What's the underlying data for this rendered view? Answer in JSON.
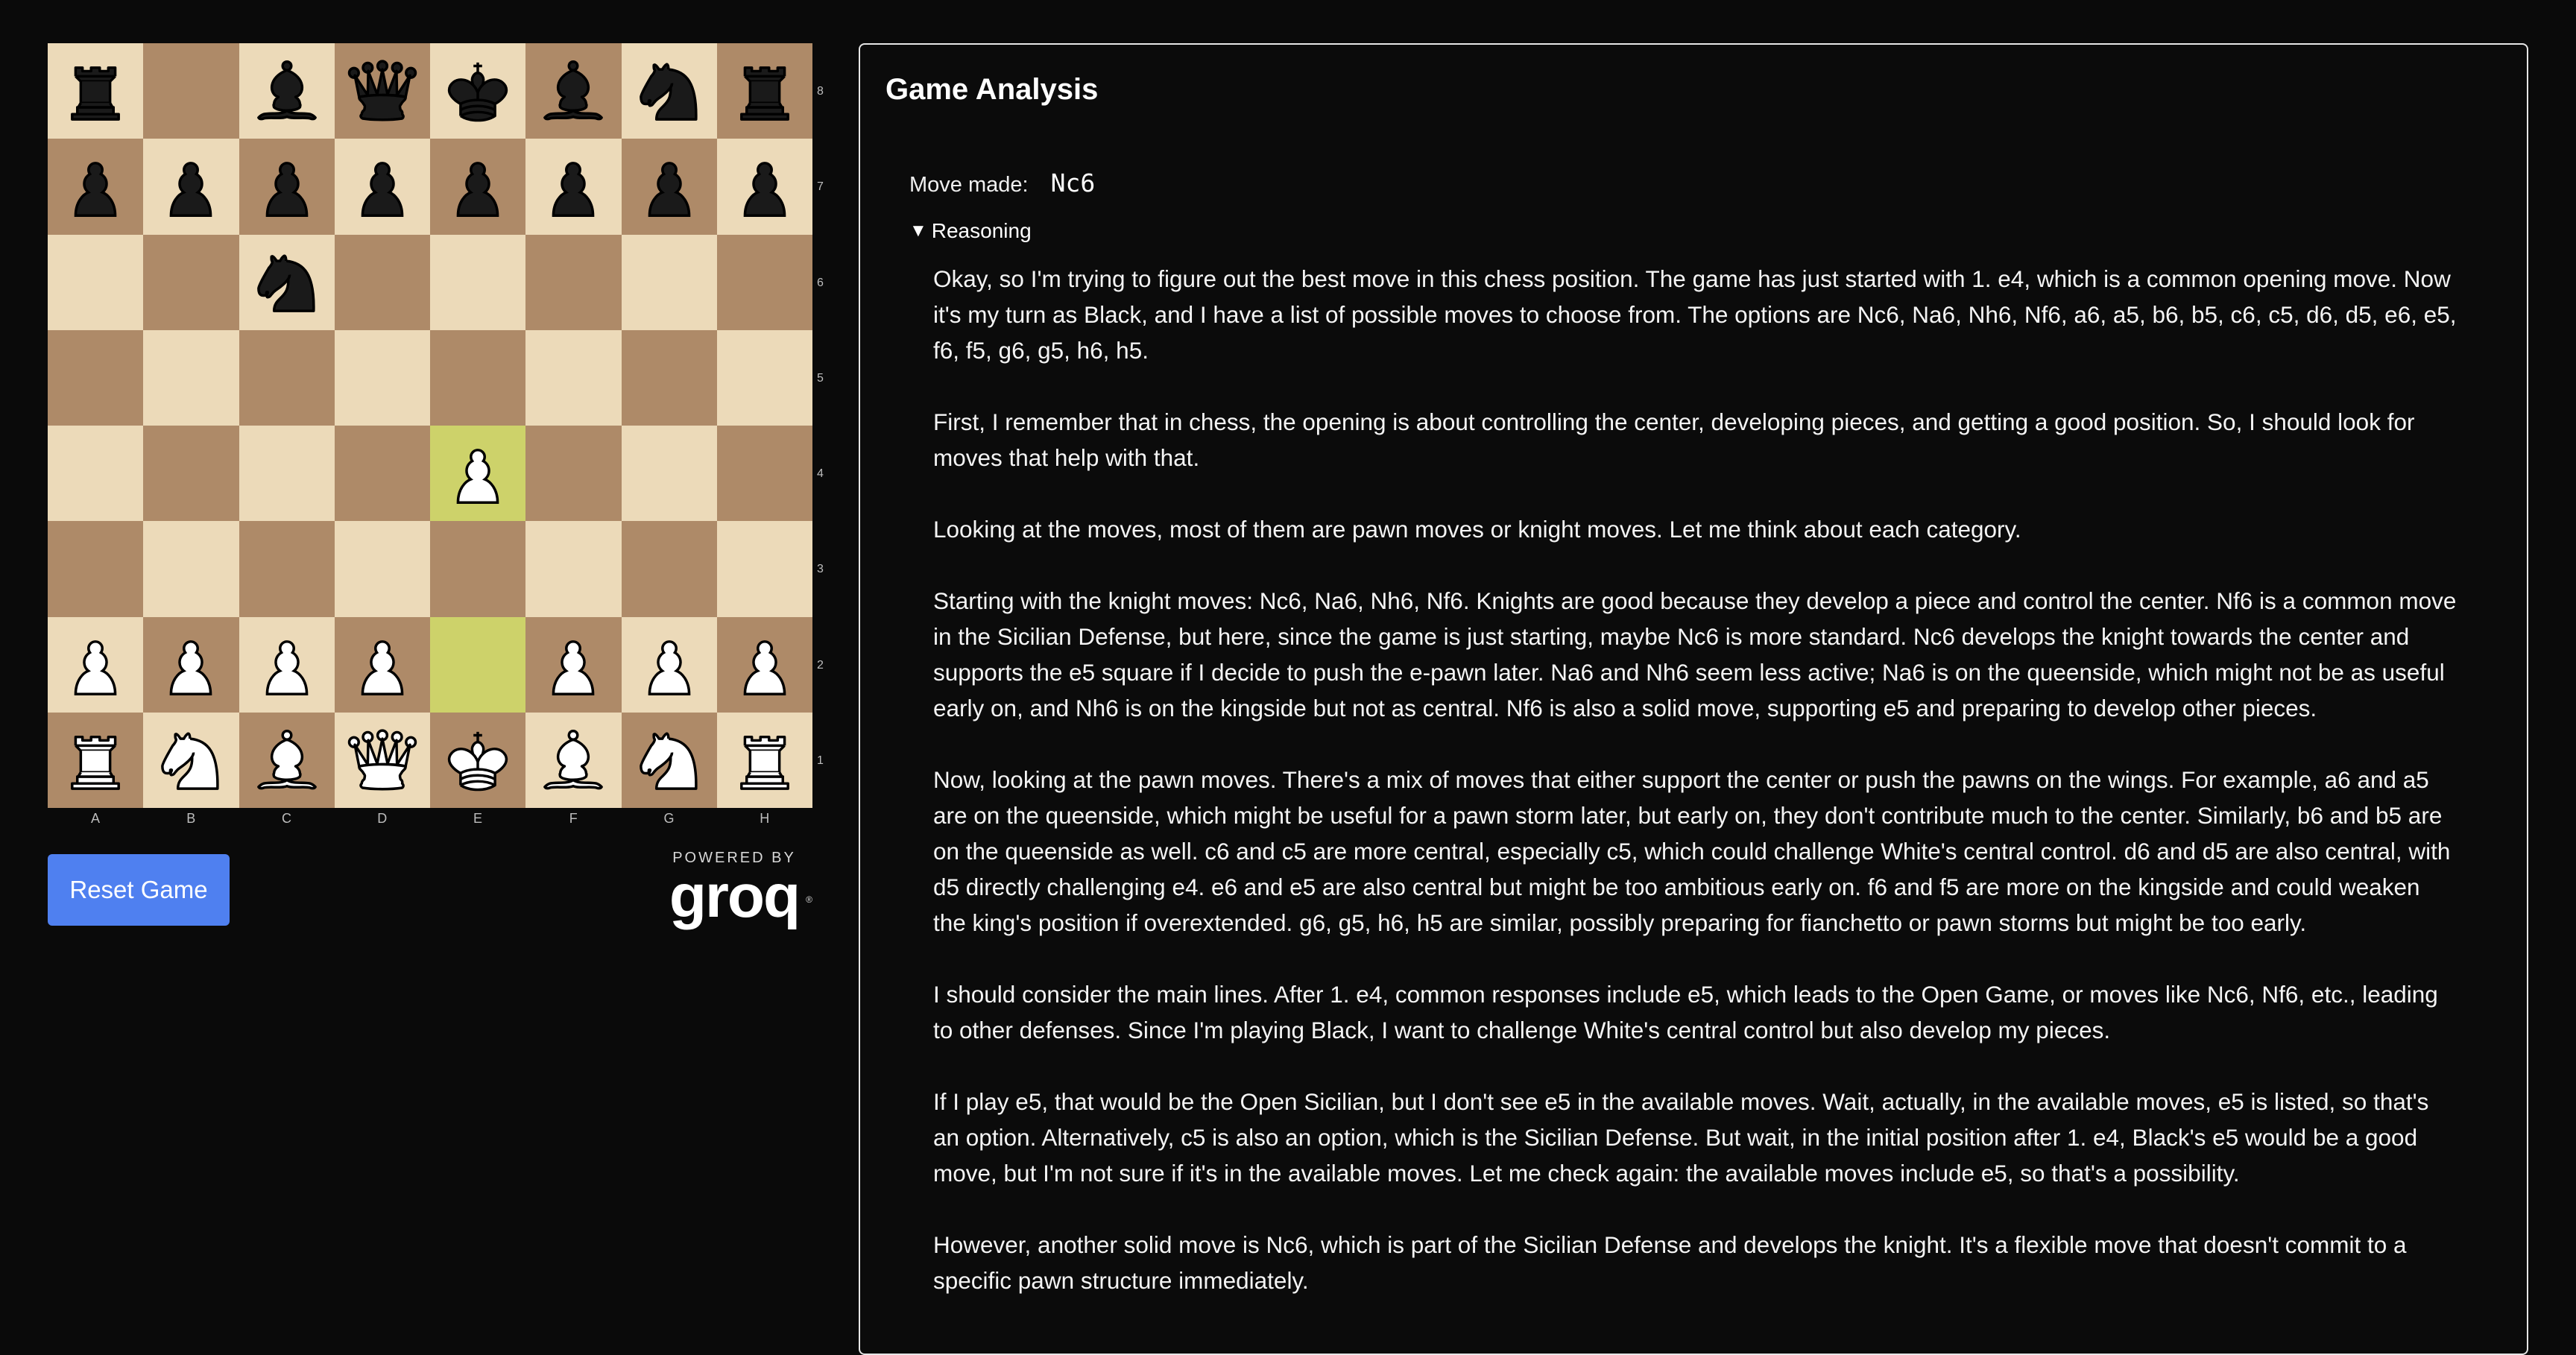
{
  "board": {
    "files": [
      "A",
      "B",
      "C",
      "D",
      "E",
      "F",
      "G",
      "H"
    ],
    "ranks": [
      "8",
      "7",
      "6",
      "5",
      "4",
      "3",
      "2",
      "1"
    ],
    "position": [
      [
        "bR",
        "",
        "bB",
        "bQ",
        "bK",
        "bB",
        "bN",
        "bR"
      ],
      [
        "bP",
        "bP",
        "bP",
        "bP",
        "bP",
        "bP",
        "bP",
        "bP"
      ],
      [
        "",
        "",
        "bN",
        "",
        "",
        "",
        "",
        ""
      ],
      [
        "",
        "",
        "",
        "",
        "",
        "",
        "",
        ""
      ],
      [
        "",
        "",
        "",
        "",
        "wP",
        "",
        "",
        ""
      ],
      [
        "",
        "",
        "",
        "",
        "",
        "",
        "",
        ""
      ],
      [
        "wP",
        "wP",
        "wP",
        "wP",
        "",
        "wP",
        "wP",
        "wP"
      ],
      [
        "wR",
        "wN",
        "wB",
        "wQ",
        "wK",
        "wB",
        "wN",
        "wR"
      ]
    ],
    "highlighted_squares": [
      "e4",
      "e2"
    ],
    "colors": {
      "light": "#ecdab9",
      "dark": "#ae8a68",
      "highlight": "#cdd26a"
    }
  },
  "controls": {
    "reset_label": "Reset Game",
    "powered_by": "POWERED BY",
    "logo_text": "groq",
    "logo_mark": "®"
  },
  "analysis": {
    "title": "Game Analysis",
    "move_label": "Move made:",
    "move_value": "Nc6",
    "reasoning_label": "Reasoning",
    "paragraphs": [
      "Okay, so I'm trying to figure out the best move in this chess position. The game has just started with 1. e4, which is a common opening move. Now it's my turn as Black, and I have a list of possible moves to choose from. The options are Nc6, Na6, Nh6, Nf6, a6, a5, b6, b5, c6, c5, d6, d5, e6, e5, f6, f5, g6, g5, h6, h5.",
      "First, I remember that in chess, the opening is about controlling the center, developing pieces, and getting a good position. So, I should look for moves that help with that.",
      "Looking at the moves, most of them are pawn moves or knight moves. Let me think about each category.",
      "Starting with the knight moves: Nc6, Na6, Nh6, Nf6. Knights are good because they develop a piece and control the center. Nf6 is a common move in the Sicilian Defense, but here, since the game is just starting, maybe Nc6 is more standard. Nc6 develops the knight towards the center and supports the e5 square if I decide to push the e-pawn later. Na6 and Nh6 seem less active; Na6 is on the queenside, which might not be as useful early on, and Nh6 is on the kingside but not as central. Nf6 is also a solid move, supporting e5 and preparing to develop other pieces.",
      "Now, looking at the pawn moves. There's a mix of moves that either support the center or push the pawns on the wings. For example, a6 and a5 are on the queenside, which might be useful for a pawn storm later, but early on, they don't contribute much to the center. Similarly, b6 and b5 are on the queenside as well. c6 and c5 are more central, especially c5, which could challenge White's central control. d6 and d5 are also central, with d5 directly challenging e4. e6 and e5 are also central but might be too ambitious early on. f6 and f5 are more on the kingside and could weaken the king's position if overextended. g6, g5, h6, h5 are similar, possibly preparing for fianchetto or pawn storms but might be too early.",
      "I should consider the main lines. After 1. e4, common responses include e5, which leads to the Open Game, or moves like Nc6, Nf6, etc., leading to other defenses. Since I'm playing Black, I want to challenge White's central control but also develop my pieces.",
      "If I play e5, that would be the Open Sicilian, but I don't see e5 in the available moves. Wait, actually, in the available moves, e5 is listed, so that's an option. Alternatively, c5 is also an option, which is the Sicilian Defense. But wait, in the initial position after 1. e4, Black's e5 would be a good move, but I'm not sure if it's in the available moves. Let me check again: the available moves include e5, so that's a possibility.",
      "However, another solid move is Nc6, which is part of the Sicilian Defense and develops the knight. It's a flexible move that doesn't commit to a specific pawn structure immediately."
    ]
  }
}
